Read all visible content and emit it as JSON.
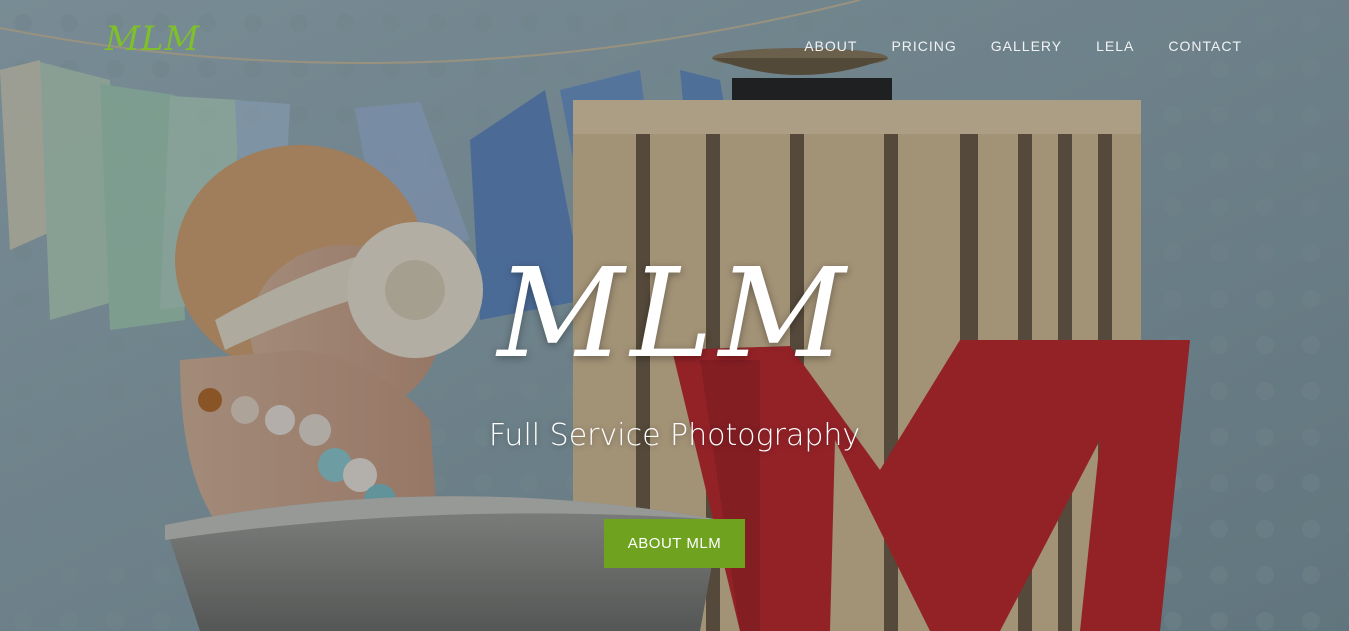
{
  "nav": {
    "brand": "MLM",
    "links": [
      "ABOUT",
      "PRICING",
      "GALLERY",
      "LELA",
      "CONTACT"
    ]
  },
  "hero": {
    "title": "MLM",
    "subtitle": "Full Service Photography",
    "cta_label": "ABOUT MLM"
  },
  "colors": {
    "brand_green": "#7fbf2b",
    "button_green": "#6ea21f",
    "text_white": "#ffffff"
  }
}
